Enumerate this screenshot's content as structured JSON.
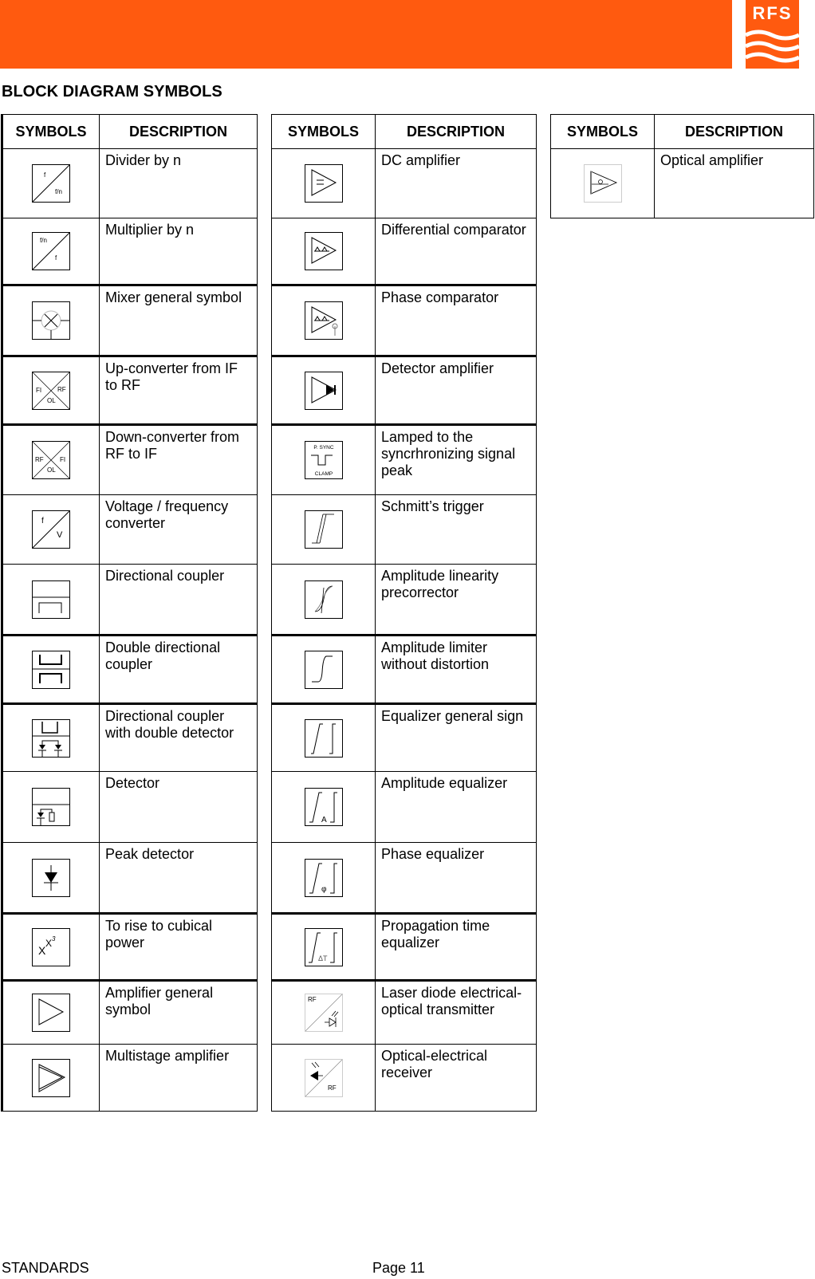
{
  "header": {
    "brand": "RFS",
    "banner_color": "#ff5a0f"
  },
  "title": "BLOCK DIAGRAM SYMBOLS",
  "columns": {
    "symbols": "SYMBOLS",
    "description": "DESCRIPTION"
  },
  "tables": [
    {
      "rows": [
        {
          "icon": "divider-by-n-icon",
          "labels": [
            "f",
            "f/n"
          ],
          "description": "Divider by n"
        },
        {
          "icon": "multiplier-by-n-icon",
          "labels": [
            "f/n",
            "f"
          ],
          "description": "Multiplier by n"
        },
        {
          "icon": "mixer-icon",
          "description": "Mixer general symbol"
        },
        {
          "icon": "up-converter-icon",
          "labels": [
            "FI",
            "RF",
            "OL"
          ],
          "description": "Up-converter from IF to RF"
        },
        {
          "icon": "down-converter-icon",
          "labels": [
            "RF",
            "FI",
            "OL"
          ],
          "description": "Down-converter from RF to IF"
        },
        {
          "icon": "voltage-frequency-converter-icon",
          "labels": [
            "f",
            "V"
          ],
          "description": "Voltage / frequency converter"
        },
        {
          "icon": "directional-coupler-icon",
          "description": "Directional coupler"
        },
        {
          "icon": "double-directional-coupler-icon",
          "description": "Double directional coupler"
        },
        {
          "icon": "directional-coupler-double-detector-icon",
          "description": "Directional coupler with double detector"
        },
        {
          "icon": "detector-icon",
          "description": "Detector"
        },
        {
          "icon": "peak-detector-icon",
          "description": "Peak detector"
        },
        {
          "icon": "cubical-power-icon",
          "labels": [
            "X",
            "X",
            "3"
          ],
          "description": "To rise to cubical power"
        },
        {
          "icon": "amplifier-icon",
          "description": "Amplifier general symbol"
        },
        {
          "icon": "multistage-amplifier-icon",
          "description": "Multistage amplifier"
        }
      ]
    },
    {
      "rows": [
        {
          "icon": "dc-amplifier-icon",
          "description": "DC amplifier"
        },
        {
          "icon": "differential-comparator-icon",
          "description": "Differential comparator"
        },
        {
          "icon": "phase-comparator-icon",
          "description": "Phase comparator"
        },
        {
          "icon": "detector-amplifier-icon",
          "description": "Detector amplifier"
        },
        {
          "icon": "sync-clamp-icon",
          "labels": [
            "P. SYNC",
            "CLAMP"
          ],
          "description": "Lamped to the syncrhronizing signal peak"
        },
        {
          "icon": "schmitt-trigger-icon",
          "description": "Schmitt’s trigger"
        },
        {
          "icon": "linearity-precorrector-icon",
          "description": "Amplitude linearity precorrector"
        },
        {
          "icon": "amplitude-limiter-icon",
          "description": "Amplitude limiter without distortion"
        },
        {
          "icon": "equalizer-icon",
          "description": "Equalizer general sign"
        },
        {
          "icon": "amplitude-equalizer-icon",
          "labels": [
            "A"
          ],
          "description": "Amplitude equalizer"
        },
        {
          "icon": "phase-equalizer-icon",
          "labels": [
            "φ"
          ],
          "description": "Phase equalizer"
        },
        {
          "icon": "propagation-time-equalizer-icon",
          "labels": [
            "ΔT"
          ],
          "description": "Propagation time equalizer"
        },
        {
          "icon": "laser-diode-transmitter-icon",
          "labels": [
            "RF"
          ],
          "description": "Laser diode electrical-optical transmitter"
        },
        {
          "icon": "optical-receiver-icon",
          "labels": [
            "RF"
          ],
          "description": "Optical-electrical receiver"
        }
      ]
    },
    {
      "rows": [
        {
          "icon": "optical-amplifier-icon",
          "description": "Optical amplifier"
        }
      ]
    }
  ],
  "footer": {
    "left": "STANDARDS",
    "page": "Page 11"
  }
}
